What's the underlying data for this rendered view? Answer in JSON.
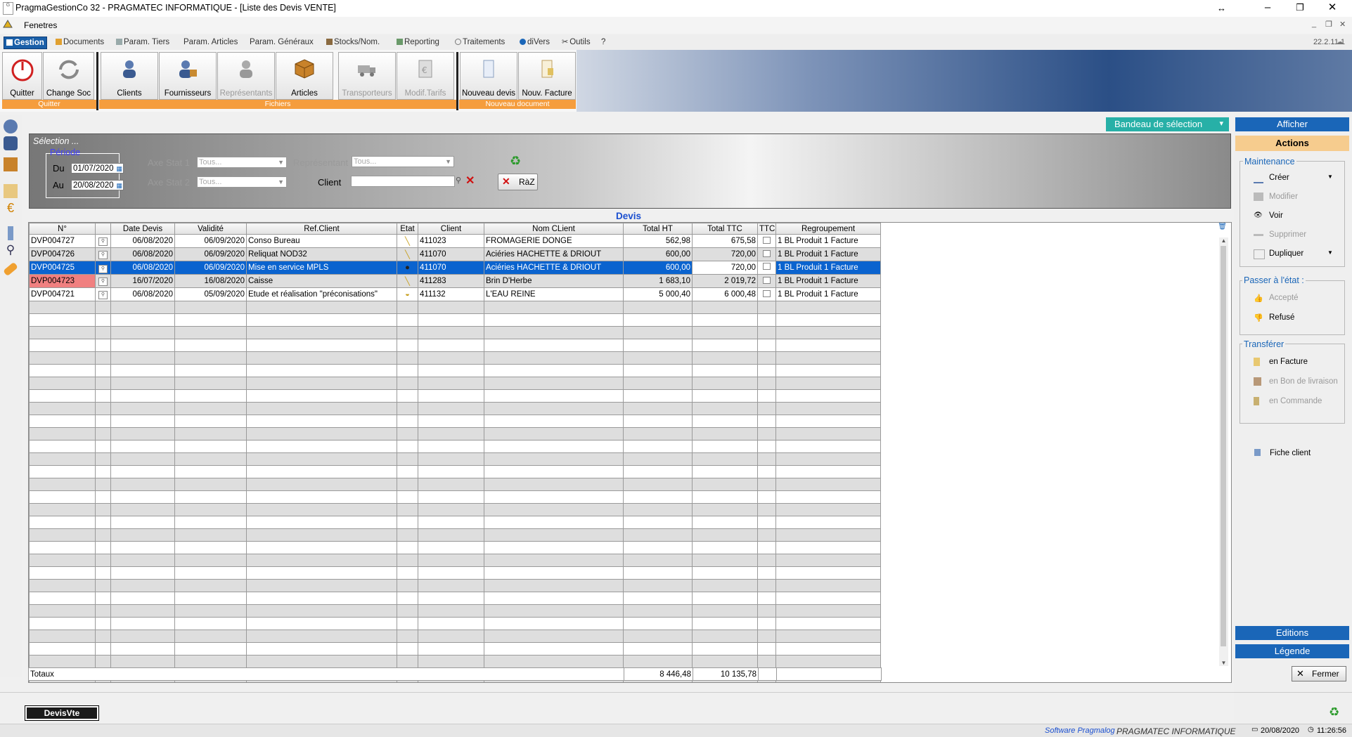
{
  "window": {
    "title": "PragmaGestionCo 32 - PRAGMATEC INFORMATIQUE - [Liste des Devis VENTE]",
    "app_icon_text": "G",
    "menu": "Fenetres"
  },
  "tabs": [
    "Gestion",
    "Documents",
    "Param. Tiers",
    "Param. Articles",
    "Param. Généraux",
    "Stocks/Nom.",
    "Reporting",
    "Traitements",
    "diVers",
    "Outils",
    "?"
  ],
  "version": "22.2.11.1",
  "ribbon": {
    "buttons": {
      "quitter": "Quitter",
      "change_soc": "Change Soc",
      "clients": "Clients",
      "fournisseurs": "Fournisseurs",
      "representants": "Représentants",
      "articles": "Articles",
      "transporteurs": "Transporteurs",
      "modif_tarifs": "Modif.Tarifs",
      "nouveau_devis": "Nouveau devis",
      "nouv_facture": "Nouv. Facture"
    },
    "groups": [
      "Quitter",
      "Fichiers",
      "Nouveau document"
    ]
  },
  "selection": {
    "bandeau": "Bandeau de sélection",
    "title": "Sélection ...",
    "periode": "Période",
    "du_label": "Du",
    "du_value": "01/07/2020",
    "au_label": "Au",
    "au_value": "20/08/2020",
    "axe1_label": "Axe Stat 1",
    "axe1_value": "Tous...",
    "axe2_label": "Axe Stat 2",
    "axe2_value": "Tous...",
    "rep_label": "Représentant",
    "rep_value": "Tous...",
    "client_label": "Client",
    "client_value": "",
    "raz": "RàZ"
  },
  "grid": {
    "title": "Devis",
    "columns": [
      "N°",
      "",
      "Date Devis",
      "Validité",
      "Ref.Client",
      "Etat",
      "Client",
      "Nom CLient",
      "Total HT",
      "Total TTC",
      "TTC",
      "Regroupement"
    ],
    "rows": [
      {
        "num": "DVP004727",
        "date": "06/08/2020",
        "validite": "06/09/2020",
        "ref": "Conso Bureau",
        "client": "411023",
        "nom": "FROMAGERIE DONGE",
        "ht": "562,98",
        "ttc": "675,58",
        "regroup": "1 BL Produit 1 Facture"
      },
      {
        "num": "DVP004726",
        "date": "06/08/2020",
        "validite": "06/09/2020",
        "ref": "Reliquat NOD32",
        "client": "411070",
        "nom": "Aciéries HACHETTE & DRIOUT",
        "ht": "600,00",
        "ttc": "720,00",
        "regroup": "1 BL Produit 1 Facture"
      },
      {
        "num": "DVP004725",
        "date": "06/08/2020",
        "validite": "06/09/2020",
        "ref": "Mise en service MPLS",
        "client": "411070",
        "nom": "Aciéries HACHETTE & DRIOUT",
        "ht": "600,00",
        "ttc": "720,00",
        "regroup": "1 BL Produit 1 Facture"
      },
      {
        "num": "DVP004723",
        "date": "16/07/2020",
        "validite": "16/08/2020",
        "ref": "Caisse",
        "client": "411283",
        "nom": "Brin D'Herbe",
        "ht": "1 683,10",
        "ttc": "2 019,72",
        "regroup": "1 BL Produit 1 Facture"
      },
      {
        "num": "DVP004721",
        "date": "06/08/2020",
        "validite": "05/09/2020",
        "ref": "Etude et réalisation \"préconisations\"",
        "client": "411132",
        "nom": "L'EAU REINE",
        "ht": "5 000,40",
        "ttc": "6 000,48",
        "regroup": "1 BL Produit 1 Facture"
      }
    ],
    "totals_label": "Totaux",
    "total_ht": "8 446,48",
    "total_ttc": "10 135,78"
  },
  "right_panel": {
    "afficher": "Afficher",
    "actions": "Actions",
    "maintenance": "Maintenance",
    "creer": "Créer",
    "modifier": "Modifier",
    "voir": "Voir",
    "supprimer": "Supprimer",
    "dupliquer": "Dupliquer",
    "passer": "Passer à l'état :",
    "accepte": "Accepté",
    "refuse": "Refusé",
    "transferer": "Transférer",
    "en_facture": "en Facture",
    "en_bl": "en Bon de livraison",
    "en_commande": "en Commande",
    "fiche_client": "Fiche client",
    "editions": "Editions",
    "legende": "Légende",
    "fermer": "Fermer"
  },
  "bottom": {
    "tab": "DevisVte",
    "software": "Software Pragmalog",
    "company": "PRAGMATEC INFORMATIQUE",
    "date": "20/08/2020",
    "time": "11:26:56"
  },
  "colors": {
    "selected_row": "#0a63cf",
    "late_row_num": "#f08080",
    "accent_blue": "#1a66b8",
    "group_orange": "#f59d3d",
    "bandeau_teal": "#27b0a7"
  }
}
